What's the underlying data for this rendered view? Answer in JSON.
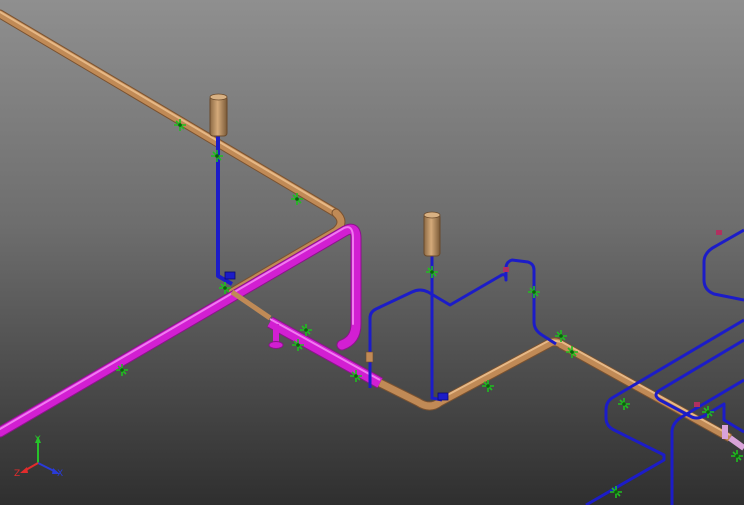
{
  "viewport": {
    "background_top": "#8f8f8f",
    "background_bottom": "#2f2f2f"
  },
  "pipes": {
    "copper_color": "#c08a56",
    "copper_highlight": "#e6b886",
    "blue_color": "#1c1cc8",
    "magenta_color": "#d21fd2",
    "magenta_highlight": "#f07af0"
  },
  "support_color": "#1fbf1f",
  "triad": {
    "x_label": "X",
    "y_label": "Y",
    "z_label": "Z",
    "x_color": "#2a3bd9",
    "y_color": "#27c22a",
    "z_color": "#e22c2c"
  }
}
